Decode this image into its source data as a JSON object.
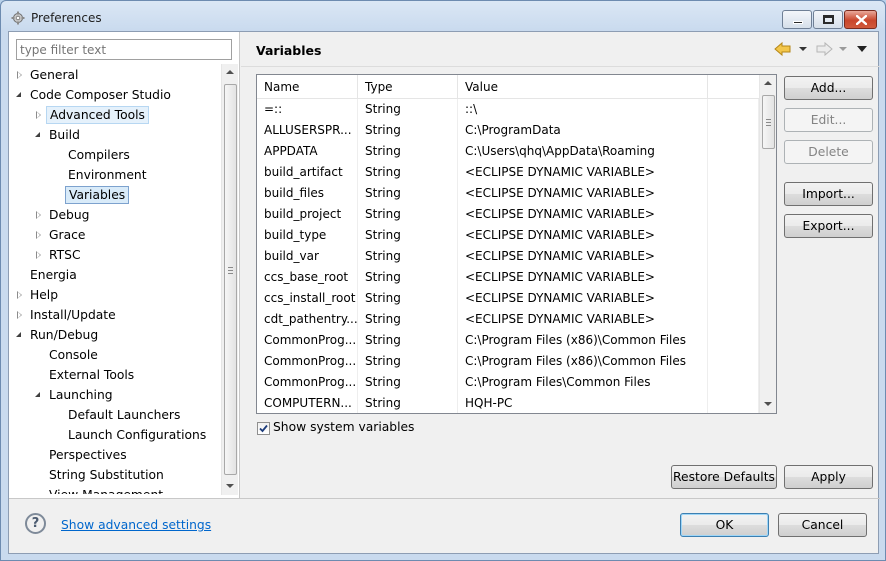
{
  "window": {
    "title": "Preferences"
  },
  "filter": {
    "placeholder": "type filter text"
  },
  "tree": [
    {
      "label": "General",
      "level": 0,
      "twisty": "closed"
    },
    {
      "label": "Code Composer Studio",
      "level": 0,
      "twisty": "open"
    },
    {
      "label": "Advanced Tools",
      "level": 1,
      "twisty": "closed",
      "state": "hover"
    },
    {
      "label": "Build",
      "level": 1,
      "twisty": "open"
    },
    {
      "label": "Compilers",
      "level": 2,
      "twisty": "none"
    },
    {
      "label": "Environment",
      "level": 2,
      "twisty": "none"
    },
    {
      "label": "Variables",
      "level": 2,
      "twisty": "none",
      "state": "selected"
    },
    {
      "label": "Debug",
      "level": 1,
      "twisty": "closed"
    },
    {
      "label": "Grace",
      "level": 1,
      "twisty": "closed"
    },
    {
      "label": "RTSC",
      "level": 1,
      "twisty": "closed"
    },
    {
      "label": "Energia",
      "level": 0,
      "twisty": "none"
    },
    {
      "label": "Help",
      "level": 0,
      "twisty": "closed"
    },
    {
      "label": "Install/Update",
      "level": 0,
      "twisty": "closed"
    },
    {
      "label": "Run/Debug",
      "level": 0,
      "twisty": "open"
    },
    {
      "label": "Console",
      "level": 1,
      "twisty": "none"
    },
    {
      "label": "External Tools",
      "level": 1,
      "twisty": "none"
    },
    {
      "label": "Launching",
      "level": 1,
      "twisty": "open"
    },
    {
      "label": "Default Launchers",
      "level": 2,
      "twisty": "none"
    },
    {
      "label": "Launch Configurations",
      "level": 2,
      "twisty": "none"
    },
    {
      "label": "Perspectives",
      "level": 1,
      "twisty": "none"
    },
    {
      "label": "String Substitution",
      "level": 1,
      "twisty": "none"
    },
    {
      "label": "View Management",
      "level": 1,
      "twisty": "none"
    }
  ],
  "page": {
    "title": "Variables"
  },
  "table": {
    "columns": [
      "Name",
      "Type",
      "Value"
    ],
    "rows": [
      [
        "=::",
        "String",
        "::\\"
      ],
      [
        "ALLUSERSPR...",
        "String",
        "C:\\ProgramData"
      ],
      [
        "APPDATA",
        "String",
        "C:\\Users\\qhq\\AppData\\Roaming"
      ],
      [
        "build_artifact",
        "String",
        "<ECLIPSE DYNAMIC VARIABLE>"
      ],
      [
        "build_files",
        "String",
        "<ECLIPSE DYNAMIC VARIABLE>"
      ],
      [
        "build_project",
        "String",
        "<ECLIPSE DYNAMIC VARIABLE>"
      ],
      [
        "build_type",
        "String",
        "<ECLIPSE DYNAMIC VARIABLE>"
      ],
      [
        "build_var",
        "String",
        "<ECLIPSE DYNAMIC VARIABLE>"
      ],
      [
        "ccs_base_root",
        "String",
        "<ECLIPSE DYNAMIC VARIABLE>"
      ],
      [
        "ccs_install_root",
        "String",
        "<ECLIPSE DYNAMIC VARIABLE>"
      ],
      [
        "cdt_pathentry...",
        "String",
        "<ECLIPSE DYNAMIC VARIABLE>"
      ],
      [
        "CommonProg...",
        "String",
        "C:\\Program Files (x86)\\Common Files"
      ],
      [
        "CommonProg...",
        "String",
        "C:\\Program Files (x86)\\Common Files"
      ],
      [
        "CommonProg...",
        "String",
        "C:\\Program Files\\Common Files"
      ],
      [
        "COMPUTERN...",
        "String",
        "HQH-PC"
      ]
    ]
  },
  "buttons": {
    "add": "Add...",
    "edit": "Edit...",
    "delete": "Delete",
    "import": "Import...",
    "export": "Export...",
    "restore_defaults": "Restore Defaults",
    "apply": "Apply",
    "ok": "OK",
    "cancel": "Cancel"
  },
  "show_system_variables": {
    "label": "Show system variables",
    "checked": true
  },
  "footer": {
    "advanced_link": "Show advanced settings",
    "help_glyph": "?"
  },
  "icons": {
    "app": "preferences-gear-icon",
    "back": "back-arrow-icon",
    "forward": "forward-arrow-icon",
    "menu": "view-menu-icon"
  },
  "colors": {
    "link": "#0066cc",
    "selection": "#d9ebf9",
    "close_button": "#c9462c",
    "nav_arrow": "#e8b43a"
  }
}
